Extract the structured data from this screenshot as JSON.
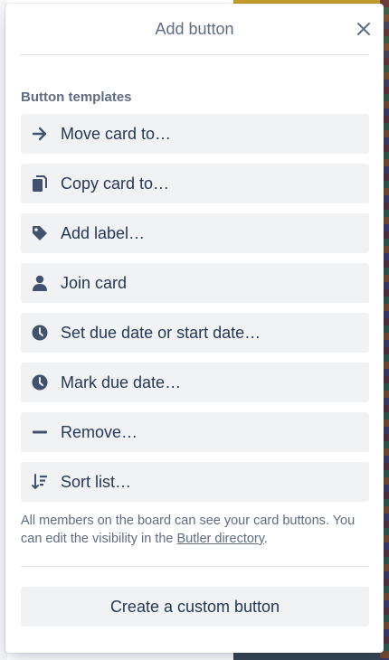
{
  "popover": {
    "title": "Add button",
    "section_title": "Button templates",
    "templates": [
      {
        "label": "Move card to…",
        "icon": "arrow-right-icon"
      },
      {
        "label": "Copy card to…",
        "icon": "copy-icon"
      },
      {
        "label": "Add label…",
        "icon": "label-tag-icon"
      },
      {
        "label": "Join card",
        "icon": "person-icon"
      },
      {
        "label": "Set due date or start date…",
        "icon": "clock-icon"
      },
      {
        "label": "Mark due date…",
        "icon": "clock-icon"
      },
      {
        "label": "Remove…",
        "icon": "minus-icon"
      },
      {
        "label": "Sort list…",
        "icon": "sort-icon"
      }
    ],
    "note_text": "All members on the board can see your card buttons. You can edit the visibility in the ",
    "note_link": "Butler directory",
    "note_end": ".",
    "custom_button_label": "Create a custom button"
  },
  "colors": {
    "icon": "#42526e",
    "button_bg": "#f1f2f4",
    "text": "#253858",
    "muted": "#5e6c84"
  }
}
